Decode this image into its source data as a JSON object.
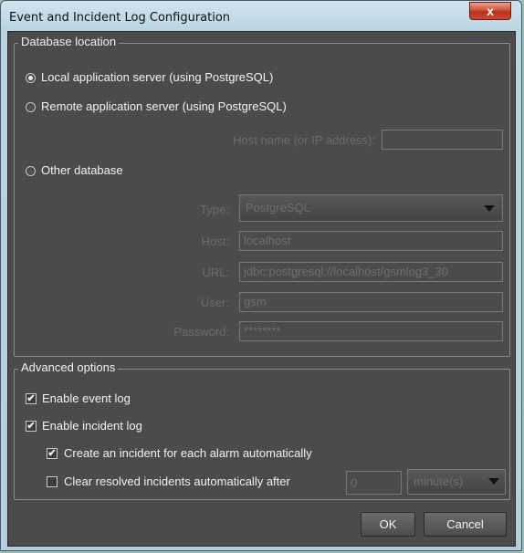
{
  "window": {
    "title": "Event and Incident Log Configuration",
    "close_label": "x"
  },
  "database_location": {
    "legend": "Database location",
    "local_label": "Local application server (using PostgreSQL)",
    "remote_label": "Remote application server (using PostgreSQL)",
    "hostname_label": "Host name (or IP address):",
    "hostname_value": "",
    "other_label": "Other database",
    "type_label": "Type:",
    "type_value": "PostgreSQL",
    "host_label": "Host:",
    "host_value": "localhost",
    "url_label": "URL:",
    "url_value": "jdbc:postgresql://localhost/gsmlog3_30",
    "user_label": "User:",
    "user_value": "gsm",
    "password_label": "Password:",
    "password_value": "********",
    "selected": "local"
  },
  "advanced": {
    "legend": "Advanced options",
    "enable_event_log_label": "Enable event log",
    "enable_event_log_checked": true,
    "enable_incident_log_label": "Enable incident log",
    "enable_incident_log_checked": true,
    "create_incident_label": "Create an incident for each alarm automatically",
    "create_incident_checked": true,
    "clear_resolved_label": "Clear resolved incidents automatically after",
    "clear_resolved_checked": false,
    "clear_value": "0",
    "clear_unit": "minute(s)"
  },
  "buttons": {
    "ok": "OK",
    "cancel": "Cancel"
  },
  "check_glyph": "✔"
}
